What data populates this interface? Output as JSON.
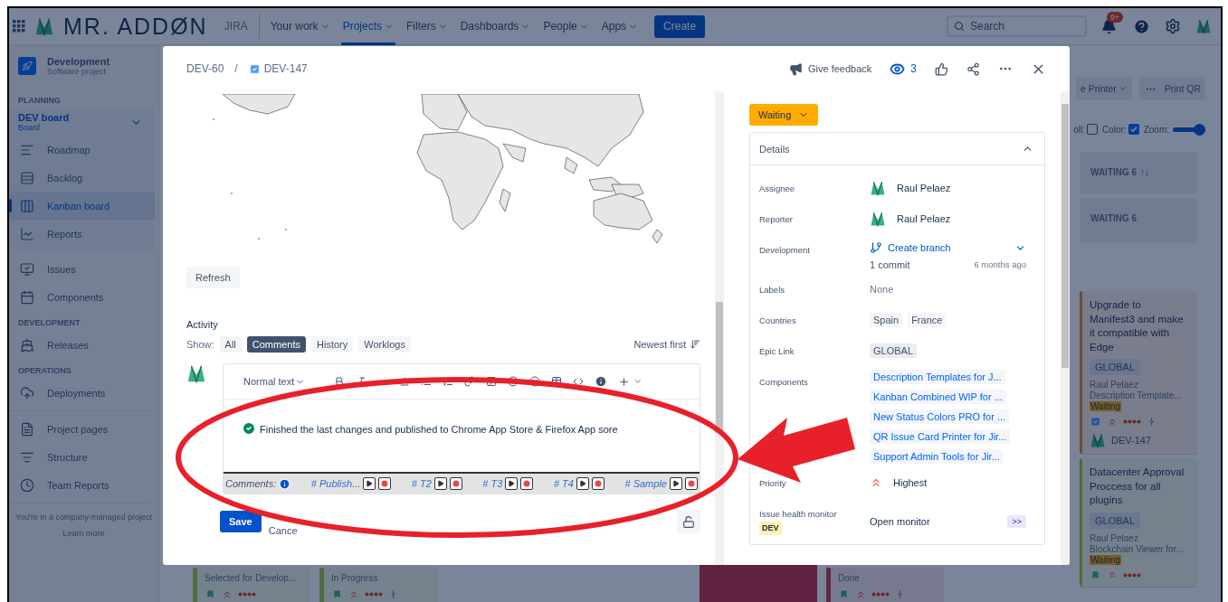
{
  "nav": {
    "logo": "MR. ADDØN",
    "product": "JIRA",
    "menu": [
      {
        "label": "Your work",
        "selected": false
      },
      {
        "label": "Projects",
        "selected": true
      },
      {
        "label": "Filters",
        "selected": false
      },
      {
        "label": "Dashboards",
        "selected": false
      },
      {
        "label": "People",
        "selected": false
      },
      {
        "label": "Apps",
        "selected": false
      }
    ],
    "create": "Create",
    "search": {
      "placeholder": "Search"
    },
    "notifications": "9+"
  },
  "sidebar": {
    "project": {
      "name": "Development",
      "type": "Software project"
    },
    "groups": [
      {
        "heading": "PLANNING",
        "board": {
          "name": "DEV board",
          "type": "Board"
        },
        "items": [
          {
            "label": "Roadmap",
            "selected": false
          },
          {
            "label": "Backlog",
            "selected": false
          },
          {
            "label": "Kanban board",
            "selected": true
          },
          {
            "label": "Reports",
            "selected": false
          }
        ]
      },
      {
        "items": [
          {
            "label": "Issues",
            "selected": false
          },
          {
            "label": "Components",
            "selected": false
          }
        ]
      },
      {
        "heading": "DEVELOPMENT",
        "items": [
          {
            "label": "Releases",
            "selected": false
          }
        ]
      },
      {
        "heading": "OPERATIONS",
        "items": [
          {
            "label": "Deployments",
            "selected": false
          }
        ]
      },
      {
        "items": [
          {
            "label": "Project pages",
            "selected": false
          },
          {
            "label": "Structure",
            "selected": false
          },
          {
            "label": "Team Reports",
            "selected": false
          }
        ]
      }
    ],
    "footer": {
      "text": "You're in a company-managed project",
      "link": "Learn more"
    }
  },
  "board": {
    "toolbar": [
      {
        "kind": "dropdown",
        "label": "e Printer"
      },
      {
        "kind": "more",
        "label": "Print QR"
      }
    ],
    "options": [
      {
        "kind": "checkbox",
        "label": "oll:",
        "checked": false
      },
      {
        "kind": "checkbox",
        "label": "Color:",
        "checked": true
      },
      {
        "kind": "slider",
        "label": "Zoom:",
        "level": 1
      }
    ],
    "columns": [
      {
        "cards": [
          {
            "kind": "stub",
            "status": "Selected for Develop...",
            "task": false,
            "linked": false,
            "color": "#506c40"
          }
        ]
      },
      {
        "cards": [
          {
            "kind": "stub",
            "status": "In Progress",
            "task": false,
            "linked": true,
            "color": "#506c40"
          }
        ]
      },
      {},
      {},
      {
        "cards": [
          {
            "kind": "flag",
            "color": "#61233f"
          }
        ]
      },
      {
        "cards": [
          {
            "kind": "stub",
            "status": "Done",
            "task": false,
            "linked": true,
            "color": "#612a46"
          }
        ]
      },
      {},
      {
        "headers": [
          {
            "title": "WAITING 6",
            "sort": "↑↓"
          },
          {
            "title": "WAITING 6"
          }
        ],
        "cards": [
          {
            "kind": "full",
            "title": "Upgrade to Manifest3 and make it compatible with Edge",
            "epic": "GLOBAL",
            "assignee": "Raul Pelaez",
            "component": "Description Template...",
            "status": "Waiting",
            "task": true,
            "linked": true,
            "key": "DEV-147",
            "color": "#704b37"
          },
          {
            "kind": "full",
            "title": "Datacenter Approval Proccess for all plugins",
            "epic": "GLOBAL",
            "assignee": "Raul Pelaez",
            "component": "Blockchain Viewer for...",
            "status": "Waiting",
            "task": false,
            "linked": false,
            "color": "#506c40"
          }
        ]
      }
    ]
  },
  "modal": {
    "breadcrumbs": {
      "parent": "DEV-60",
      "separator": "/",
      "current": "DEV-147"
    },
    "feedback": "Give feedback",
    "watchers": "3",
    "refresh": "Refresh",
    "activity": {
      "heading": "Activity",
      "show_label": "Show:",
      "filters": [
        {
          "label": "All",
          "selected": false
        },
        {
          "label": "Comments",
          "selected": true
        },
        {
          "label": "History",
          "selected": false
        },
        {
          "label": "Worklogs",
          "selected": false
        }
      ],
      "sort": "Newest first"
    },
    "editor": {
      "text_style": "Normal text",
      "comment": "Finished the last changes and published to Chrome App Store & Firefox App sore",
      "snippets_label": "Comments:",
      "snippets": [
        "# Publish...",
        "# T2",
        "# T3",
        "# T4",
        "# Sample"
      ],
      "save": "Save",
      "cancel": "Cance"
    },
    "status": "Waiting",
    "details": {
      "heading": "Details",
      "expanded": true,
      "fields": [
        {
          "kind": "person",
          "label": "Assignee",
          "value": "Raul Pelaez"
        },
        {
          "kind": "person",
          "label": "Reporter",
          "value": "Raul Pelaez"
        },
        {
          "kind": "branch",
          "label": "Development",
          "value": "Create branch",
          "commits": "1 commit",
          "updated": "6 months ago"
        },
        {
          "kind": "text",
          "label": "Labels",
          "value": "None"
        },
        {
          "kind": "tags",
          "label": "Countries",
          "values": [
            "Spain",
            "France"
          ]
        },
        {
          "kind": "lozenge",
          "label": "Epic Link",
          "value": "GLOBAL"
        },
        {
          "kind": "links",
          "label": "Components",
          "values": [
            "Description Templates for J...",
            "Kanban Combined WIP for ...",
            "New Status Colors PRO for ...",
            "QR Issue Card Printer for Jir...",
            "Support Admin Tools for Jir..."
          ]
        },
        {
          "kind": "priority",
          "label": "Priority",
          "value": "Highest"
        },
        {
          "kind": "monitor",
          "label": "Issue health monitor",
          "badge": "DEV",
          "value": "Open monitor",
          "action": ">>"
        }
      ]
    }
  }
}
